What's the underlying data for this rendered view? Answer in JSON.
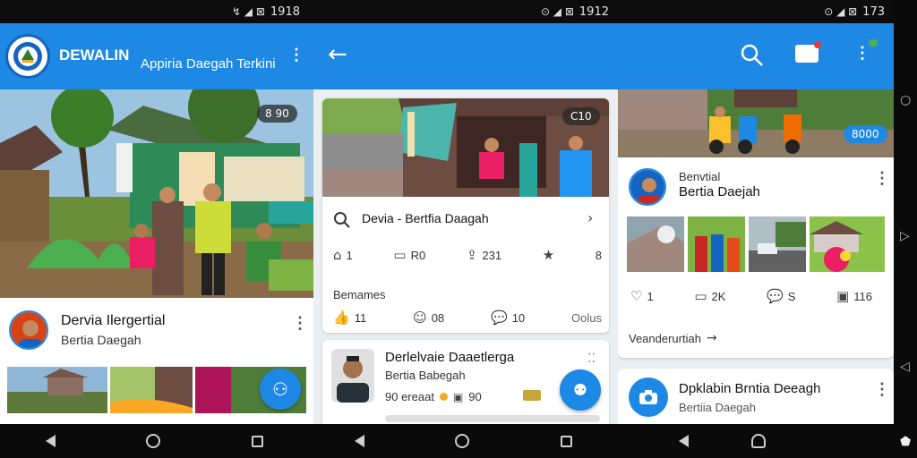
{
  "status": {
    "left_time": "1918",
    "mid_time": "1912",
    "right_time": "173",
    "left_icons": "↯ ◢ ⊠",
    "mid_icons": "⊙ ◢ ⊠",
    "right_icons": "⊙ ◢ ⊠"
  },
  "appbar_left": {
    "brand": "DEWALIN",
    "subtitle": "Appiria Daegah Terkini"
  },
  "feed_left": {
    "hero_badge": "8 90",
    "post": {
      "name": "Dervia Ilergertial",
      "subtitle": "Bertia Daegah"
    }
  },
  "feed_mid": {
    "hero_badge": "C10",
    "post_title": "Devia - Bertfia Daagah",
    "actions": [
      {
        "icon": "home-icon",
        "value": "1"
      },
      {
        "icon": "comment-icon",
        "value": "R0"
      },
      {
        "icon": "share-icon",
        "value": "231"
      },
      {
        "icon": "star-icon",
        "value": ""
      },
      {
        "icon": "more-icon",
        "value": "8"
      }
    ],
    "section_label": "Bemames",
    "stats": [
      {
        "icon": "like-icon",
        "value": "11"
      },
      {
        "icon": "smile-icon",
        "value": "08"
      },
      {
        "icon": "comment-icon",
        "value": "10"
      },
      {
        "icon": "",
        "value": "Oolus"
      }
    ],
    "card2": {
      "name": "Derlelvaie Daaetlerga",
      "subtitle": "Bertia Babegah",
      "meta": "90 ereaat",
      "meta_count": "90"
    }
  },
  "feed_right": {
    "hero_badge": "8000",
    "post": {
      "name": "Benvtial",
      "subtitle": "Bertia Daejah"
    },
    "actions": [
      {
        "icon": "like-icon",
        "value": "1"
      },
      {
        "icon": "comment-icon",
        "value": "2K"
      },
      {
        "icon": "chat-icon",
        "value": "S"
      },
      {
        "icon": "view-icon",
        "value": "116"
      }
    ],
    "more_link": "Veanderurtiah",
    "card2": {
      "name": "Dpklabin Brntia Deeagh",
      "subtitle": "Bertiia Daegah"
    }
  },
  "colors": {
    "accent": "#1e88e5",
    "background": "#eceff1"
  }
}
